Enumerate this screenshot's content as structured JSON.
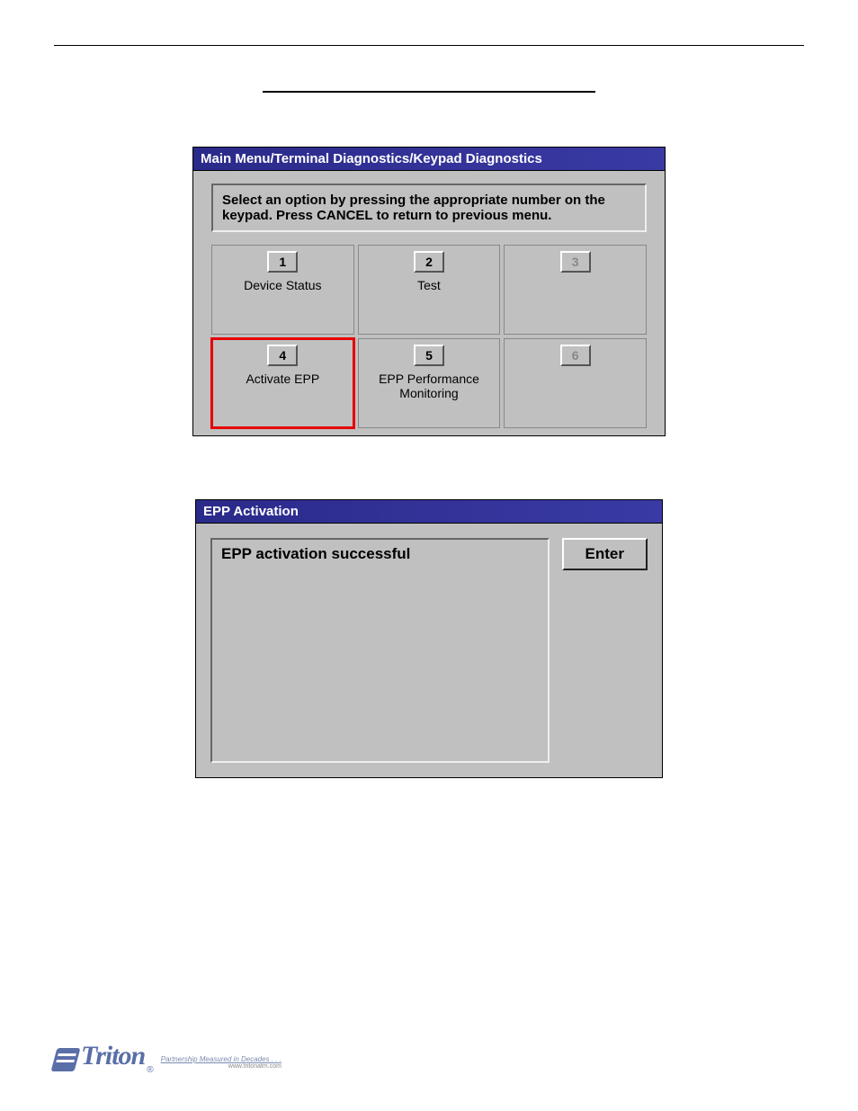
{
  "header_rule": true,
  "section_title": "",
  "win1": {
    "title": "Main Menu/Terminal Diagnostics/Keypad Diagnostics",
    "instructions": "Select an option by pressing the appropriate number on the keypad.  Press CANCEL to return to previous menu.",
    "cells": [
      {
        "num": "1",
        "label": "Device Status",
        "disabled": false,
        "highlight": false
      },
      {
        "num": "2",
        "label": "Test",
        "disabled": false,
        "highlight": false
      },
      {
        "num": "3",
        "label": "",
        "disabled": true,
        "highlight": false
      },
      {
        "num": "4",
        "label": "Activate EPP",
        "disabled": false,
        "highlight": true
      },
      {
        "num": "5",
        "label": "EPP Performance Monitoring",
        "disabled": false,
        "highlight": false
      },
      {
        "num": "6",
        "label": "",
        "disabled": true,
        "highlight": false
      }
    ]
  },
  "win2": {
    "title": "EPP Activation",
    "message": "EPP activation successful",
    "enter_label": "Enter"
  },
  "footer": {
    "brand": "Triton",
    "reg": "®",
    "tagline": "Partnership Measured in Decades . . .",
    "url": "www.tritonatm.com"
  }
}
